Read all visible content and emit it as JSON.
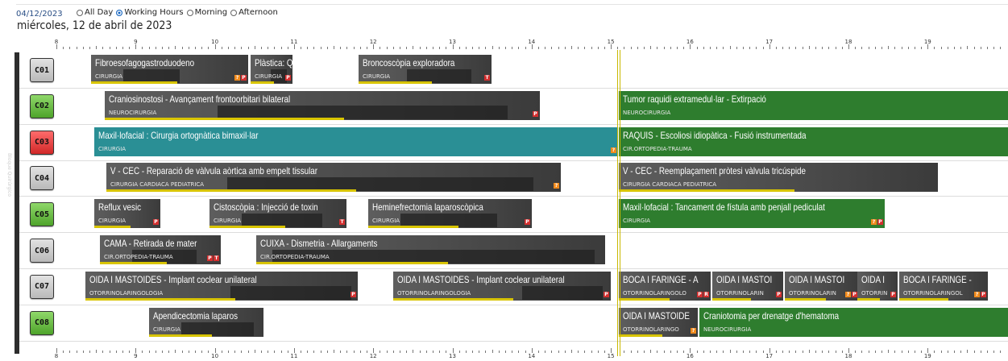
{
  "header": {
    "date_short": "04/12/2023",
    "day_title": "miércoles, 12 de abril de 2023",
    "filters": [
      {
        "label": "All Day",
        "selected": false
      },
      {
        "label": "Working Hours",
        "selected": true
      },
      {
        "label": "Morning",
        "selected": false
      },
      {
        "label": "Afternoon",
        "selected": false
      }
    ]
  },
  "timeline": {
    "hours": [
      "8",
      "9",
      "10",
      "11",
      "12",
      "13",
      "14",
      "15",
      "16",
      "17",
      "18",
      "19"
    ],
    "side_label": "Bloque Quirúrgico"
  },
  "rooms": [
    {
      "code": "C01",
      "status": "gray",
      "blocks": [
        {
          "title": "Fibroesofagogastroduodeno",
          "spec": "CIRURGIA",
          "color": "gray",
          "flags": [
            "?",
            "P"
          ]
        },
        {
          "title": "Plàstica: Qui",
          "spec": "CIRURGIA",
          "color": "gray",
          "flags": [
            "P"
          ]
        },
        {
          "title": "Broncoscòpia exploradora",
          "spec": "CIRURGIA",
          "color": "gray",
          "flags": [
            "T"
          ]
        }
      ]
    },
    {
      "code": "C02",
      "status": "green",
      "blocks": [
        {
          "title": "Craniosinostosi - Avançament frontoorbitari bilateral",
          "spec": "NEUROCIRURGIA",
          "color": "gray",
          "flags": [
            "P"
          ]
        },
        {
          "title": "Tumor raquidi extramedul·lar - Extirpació",
          "spec": "NEUROCIRURGIA",
          "color": "green",
          "flags": []
        }
      ]
    },
    {
      "code": "C03",
      "status": "red",
      "blocks": [
        {
          "title": "Maxil·lofacial : Cirurgia ortognàtica bimaxil·lar",
          "spec": "CIRURGIA",
          "color": "teal",
          "flags": [
            "?"
          ]
        },
        {
          "title": "RAQUIS - Escoliosi idiopàtica - Fusió instrumentada",
          "spec": "CIR.ORTOPEDIA-TRAUMA",
          "color": "green",
          "flags": []
        }
      ]
    },
    {
      "code": "C04",
      "status": "gray",
      "blocks": [
        {
          "title": "V - CEC - Reparació de vàlvula aòrtica amb empelt tissular",
          "spec": "CIRURGIA CARDIACA PEDIATRICA",
          "color": "gray",
          "flags": [
            "?"
          ]
        },
        {
          "title": "V - CEC - Reemplaçament pròtesi vàlvula tricúspide",
          "spec": "CIRURGIA CARDIACA PEDIATRICA",
          "color": "gray",
          "flags": []
        }
      ]
    },
    {
      "code": "C05",
      "status": "green",
      "blocks": [
        {
          "title": "Reflux vesic",
          "spec": "CIRURGIA",
          "color": "gray",
          "flags": [
            "P"
          ]
        },
        {
          "title": "Cistoscòpia : Injecció de toxin",
          "spec": "CIRURGIA",
          "color": "gray",
          "flags": [
            "T"
          ]
        },
        {
          "title": "Heminefrectomia laparoscòpica",
          "spec": "CIRURGIA",
          "color": "gray",
          "flags": [
            "P"
          ]
        },
        {
          "title": "Maxil·lofacial : Tancament de fístula amb penjall pediculat",
          "spec": "CIRURGIA",
          "color": "green",
          "flags": [
            "?",
            "P"
          ]
        }
      ]
    },
    {
      "code": "C06",
      "status": "gray",
      "blocks": [
        {
          "title": "CAMA - Retirada de mater",
          "spec": "CIR.ORTOPEDIA-TRAUMA",
          "color": "gray",
          "flags": [
            "P",
            "T"
          ]
        },
        {
          "title": "CUIXA - Dismetria - Allargaments",
          "spec": "CIR.ORTOPEDIA-TRAUMA",
          "color": "gray",
          "flags": []
        }
      ]
    },
    {
      "code": "C07",
      "status": "gray",
      "blocks": [
        {
          "title": "OIDA I MASTOIDES - Implant coclear unilateral",
          "spec": "OTORRINOLARINGOLOGIA",
          "color": "gray",
          "flags": [
            "P"
          ]
        },
        {
          "title": "OIDA I MASTOIDES - Implant coclear unilateral",
          "spec": "OTORRINOLARINGOLOGIA",
          "color": "gray",
          "flags": [
            "P"
          ]
        },
        {
          "title": "BOCA I FARINGE - A",
          "spec": "OTORRINOLARINGOLO",
          "color": "gray",
          "flags": [
            "P",
            "R"
          ]
        },
        {
          "title": "OIDA I MASTOI",
          "spec": "OTORRINOLARIN",
          "color": "gray",
          "flags": [
            "P"
          ]
        },
        {
          "title": "OIDA I MASTOI",
          "spec": "OTORRINOLARIN",
          "color": "gray",
          "flags": [
            "?",
            "P"
          ]
        },
        {
          "title": "OIDA I",
          "spec": "OTORRIN",
          "color": "gray",
          "flags": [
            "P"
          ]
        },
        {
          "title": "BOCA I FARINGE -",
          "spec": "OTORRINOLARINGOL",
          "color": "gray",
          "flags": [
            "?",
            "P"
          ]
        }
      ]
    },
    {
      "code": "C08",
      "status": "green",
      "blocks": [
        {
          "title": "Apendicectomia laparos",
          "spec": "CIRURGIA",
          "color": "gray",
          "flags": []
        },
        {
          "title": "OIDA I MASTOIDE",
          "spec": "OTORRINOLARINGO",
          "color": "gray",
          "flags": [
            "?"
          ]
        },
        {
          "title": "Craniotomia per drenatge d'hematoma",
          "spec": "NEUROCIRURGIA",
          "color": "green",
          "flags": []
        }
      ]
    }
  ]
}
